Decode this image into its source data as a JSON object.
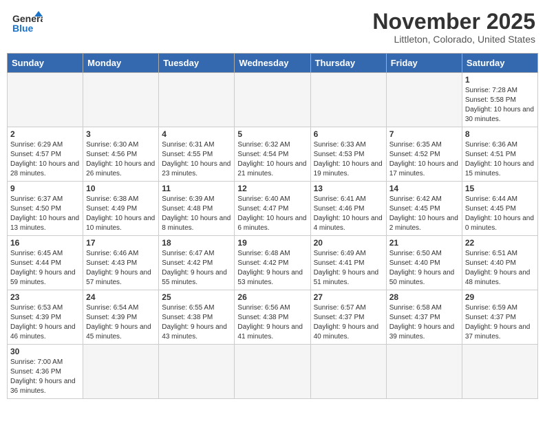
{
  "header": {
    "logo_general": "General",
    "logo_blue": "Blue",
    "month": "November 2025",
    "location": "Littleton, Colorado, United States"
  },
  "days_of_week": [
    "Sunday",
    "Monday",
    "Tuesday",
    "Wednesday",
    "Thursday",
    "Friday",
    "Saturday"
  ],
  "weeks": [
    [
      {
        "day": "",
        "info": ""
      },
      {
        "day": "",
        "info": ""
      },
      {
        "day": "",
        "info": ""
      },
      {
        "day": "",
        "info": ""
      },
      {
        "day": "",
        "info": ""
      },
      {
        "day": "",
        "info": ""
      },
      {
        "day": "1",
        "info": "Sunrise: 7:28 AM\nSunset: 5:58 PM\nDaylight: 10 hours and 30 minutes."
      }
    ],
    [
      {
        "day": "2",
        "info": "Sunrise: 6:29 AM\nSunset: 4:57 PM\nDaylight: 10 hours and 28 minutes."
      },
      {
        "day": "3",
        "info": "Sunrise: 6:30 AM\nSunset: 4:56 PM\nDaylight: 10 hours and 26 minutes."
      },
      {
        "day": "4",
        "info": "Sunrise: 6:31 AM\nSunset: 4:55 PM\nDaylight: 10 hours and 23 minutes."
      },
      {
        "day": "5",
        "info": "Sunrise: 6:32 AM\nSunset: 4:54 PM\nDaylight: 10 hours and 21 minutes."
      },
      {
        "day": "6",
        "info": "Sunrise: 6:33 AM\nSunset: 4:53 PM\nDaylight: 10 hours and 19 minutes."
      },
      {
        "day": "7",
        "info": "Sunrise: 6:35 AM\nSunset: 4:52 PM\nDaylight: 10 hours and 17 minutes."
      },
      {
        "day": "8",
        "info": "Sunrise: 6:36 AM\nSunset: 4:51 PM\nDaylight: 10 hours and 15 minutes."
      }
    ],
    [
      {
        "day": "9",
        "info": "Sunrise: 6:37 AM\nSunset: 4:50 PM\nDaylight: 10 hours and 13 minutes."
      },
      {
        "day": "10",
        "info": "Sunrise: 6:38 AM\nSunset: 4:49 PM\nDaylight: 10 hours and 10 minutes."
      },
      {
        "day": "11",
        "info": "Sunrise: 6:39 AM\nSunset: 4:48 PM\nDaylight: 10 hours and 8 minutes."
      },
      {
        "day": "12",
        "info": "Sunrise: 6:40 AM\nSunset: 4:47 PM\nDaylight: 10 hours and 6 minutes."
      },
      {
        "day": "13",
        "info": "Sunrise: 6:41 AM\nSunset: 4:46 PM\nDaylight: 10 hours and 4 minutes."
      },
      {
        "day": "14",
        "info": "Sunrise: 6:42 AM\nSunset: 4:45 PM\nDaylight: 10 hours and 2 minutes."
      },
      {
        "day": "15",
        "info": "Sunrise: 6:44 AM\nSunset: 4:45 PM\nDaylight: 10 hours and 0 minutes."
      }
    ],
    [
      {
        "day": "16",
        "info": "Sunrise: 6:45 AM\nSunset: 4:44 PM\nDaylight: 9 hours and 59 minutes."
      },
      {
        "day": "17",
        "info": "Sunrise: 6:46 AM\nSunset: 4:43 PM\nDaylight: 9 hours and 57 minutes."
      },
      {
        "day": "18",
        "info": "Sunrise: 6:47 AM\nSunset: 4:42 PM\nDaylight: 9 hours and 55 minutes."
      },
      {
        "day": "19",
        "info": "Sunrise: 6:48 AM\nSunset: 4:42 PM\nDaylight: 9 hours and 53 minutes."
      },
      {
        "day": "20",
        "info": "Sunrise: 6:49 AM\nSunset: 4:41 PM\nDaylight: 9 hours and 51 minutes."
      },
      {
        "day": "21",
        "info": "Sunrise: 6:50 AM\nSunset: 4:40 PM\nDaylight: 9 hours and 50 minutes."
      },
      {
        "day": "22",
        "info": "Sunrise: 6:51 AM\nSunset: 4:40 PM\nDaylight: 9 hours and 48 minutes."
      }
    ],
    [
      {
        "day": "23",
        "info": "Sunrise: 6:53 AM\nSunset: 4:39 PM\nDaylight: 9 hours and 46 minutes."
      },
      {
        "day": "24",
        "info": "Sunrise: 6:54 AM\nSunset: 4:39 PM\nDaylight: 9 hours and 45 minutes."
      },
      {
        "day": "25",
        "info": "Sunrise: 6:55 AM\nSunset: 4:38 PM\nDaylight: 9 hours and 43 minutes."
      },
      {
        "day": "26",
        "info": "Sunrise: 6:56 AM\nSunset: 4:38 PM\nDaylight: 9 hours and 41 minutes."
      },
      {
        "day": "27",
        "info": "Sunrise: 6:57 AM\nSunset: 4:37 PM\nDaylight: 9 hours and 40 minutes."
      },
      {
        "day": "28",
        "info": "Sunrise: 6:58 AM\nSunset: 4:37 PM\nDaylight: 9 hours and 39 minutes."
      },
      {
        "day": "29",
        "info": "Sunrise: 6:59 AM\nSunset: 4:37 PM\nDaylight: 9 hours and 37 minutes."
      }
    ],
    [
      {
        "day": "30",
        "info": "Sunrise: 7:00 AM\nSunset: 4:36 PM\nDaylight: 9 hours and 36 minutes."
      },
      {
        "day": "",
        "info": ""
      },
      {
        "day": "",
        "info": ""
      },
      {
        "day": "",
        "info": ""
      },
      {
        "day": "",
        "info": ""
      },
      {
        "day": "",
        "info": ""
      },
      {
        "day": "",
        "info": ""
      }
    ]
  ]
}
